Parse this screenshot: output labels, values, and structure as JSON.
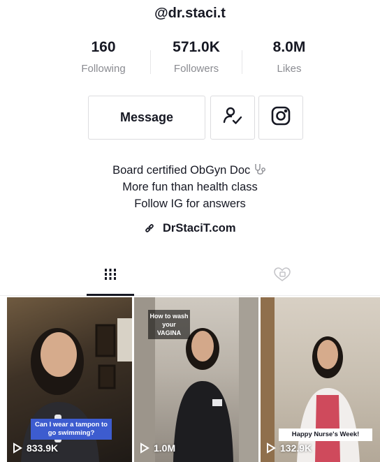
{
  "profile": {
    "username": "@dr.staci.t",
    "stats": [
      {
        "value": "160",
        "label": "Following"
      },
      {
        "value": "571.0K",
        "label": "Followers"
      },
      {
        "value": "8.0M",
        "label": "Likes"
      }
    ],
    "message_label": "Message",
    "bio": [
      "Board certified ObGyn Doc",
      "More fun than health class",
      "Follow IG for answers"
    ],
    "link": "DrStaciT.com"
  },
  "tabs": [
    {
      "icon": "grid-icon",
      "active": true
    },
    {
      "icon": "liked-videos-icon",
      "active": false
    }
  ],
  "videos": [
    {
      "views": "833.9K",
      "caption": "Can I wear a tampon to go swimming?"
    },
    {
      "views": "1.0M",
      "caption": "How to wash your VAGINA"
    },
    {
      "views": "132.9K",
      "caption": "Happy Nurse's Week!"
    }
  ],
  "colors": {
    "text": "#161823",
    "muted": "#8a8b91",
    "border": "#dcdcdf"
  }
}
